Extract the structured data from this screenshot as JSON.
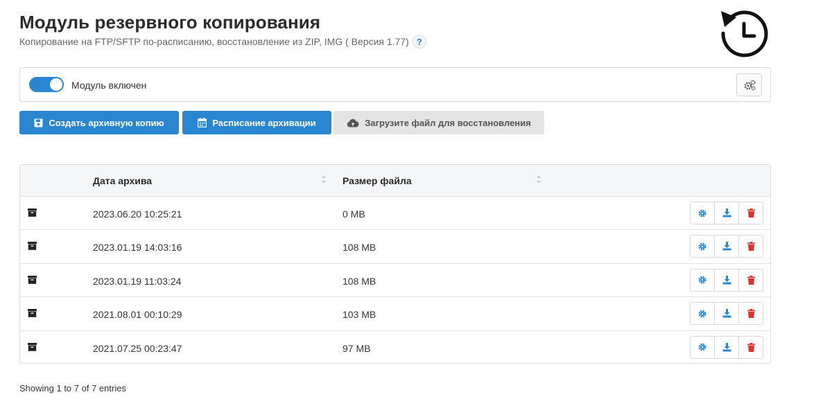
{
  "header": {
    "title": "Модуль резервного копирования",
    "subtitle": "Копирование на FTP/SFTP по-расписанию, восстановление из ZIP, IMG ( Версия 1.77)",
    "help_label": "?"
  },
  "module_panel": {
    "toggle_on": true,
    "toggle_label": "Модуль включен"
  },
  "toolbar": {
    "create_label": "Создать архивную копию",
    "schedule_label": "Расписание архивации",
    "upload_label": "Загрузите файл для восстановления"
  },
  "table": {
    "columns": [
      "",
      "Дата архива",
      "Размер файла",
      ""
    ],
    "rows": [
      {
        "date": "2023.06.20 10:25:21",
        "size": "0 MB"
      },
      {
        "date": "2023.01.19 14:03:16",
        "size": "108 MB"
      },
      {
        "date": "2023.01.19 11:03:24",
        "size": "108 MB"
      },
      {
        "date": "2021.08.01 00:10:29",
        "size": "103 MB"
      },
      {
        "date": "2021.07.25 00:23:47",
        "size": "97 MB"
      }
    ]
  },
  "footer": {
    "info": "Showing 1 to 7 of 7 entries"
  },
  "colors": {
    "primary": "#2a86d1",
    "danger": "#e03131",
    "default_button": "#e4e4e4"
  }
}
